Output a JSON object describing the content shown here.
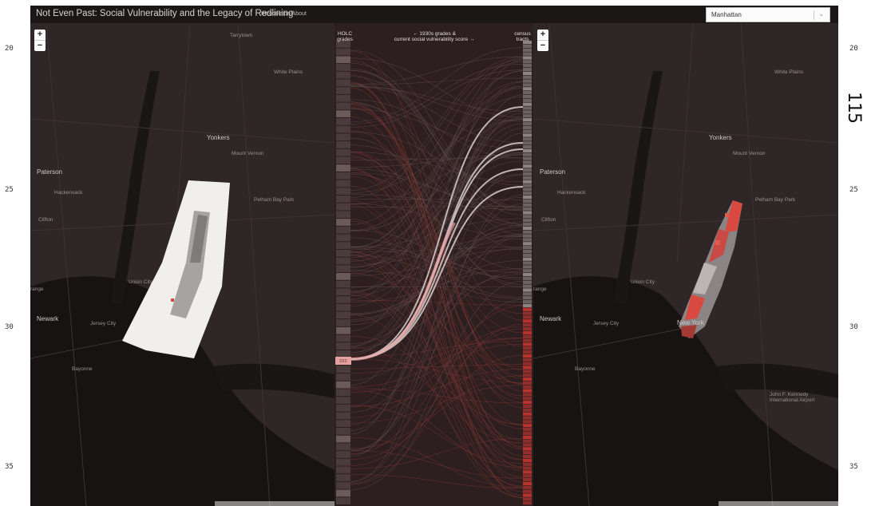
{
  "gutter": {
    "n20a": "20",
    "n25a": "25",
    "n30a": "30",
    "n35a": "35",
    "n20b": "20",
    "n25b": "25",
    "n30b": "30",
    "n35b": "35",
    "page": "115"
  },
  "header": {
    "title": "Not Even Past: Social Vulnerability and the Legacy of Redlining",
    "intro_link": "Introduction/About"
  },
  "borough_select": {
    "value": "Manhattan"
  },
  "zoom": {
    "in": "+",
    "out": "−"
  },
  "flow": {
    "left_header_1": "HOLC",
    "left_header_2": "grades",
    "center_header_1": "← 1930s grades &",
    "center_header_2": "current social vulnerability score →",
    "right_header_1": "census",
    "right_header_2": "tracts",
    "highlight": "D12"
  },
  "map_labels": {
    "yonkers": "Yonkers",
    "paterson": "Paterson",
    "mount_vernon": "Mount Vernon",
    "hackensack": "Hackensack",
    "clifton": "Clifton",
    "union_city": "Union City",
    "newark": "Newark",
    "jersey_city": "Jersey City",
    "bayonne": "Bayonne",
    "new_york": "New York",
    "white_plains": "White Plains",
    "jfk": "John F. Kennedy International Airport",
    "pelham": "Pelham Bay Park",
    "tarrytown": "Tarrytown",
    "orange": "range"
  },
  "colors": {
    "map_bg": "#2b2424",
    "flow_bg": "#2d1f1f",
    "accent_red": "#d9493f",
    "highlight": "#e5a0a0"
  },
  "icons": {
    "zoom_in": "plus-icon",
    "zoom_out": "minus-icon",
    "dropdown": "chevron-down-icon"
  }
}
